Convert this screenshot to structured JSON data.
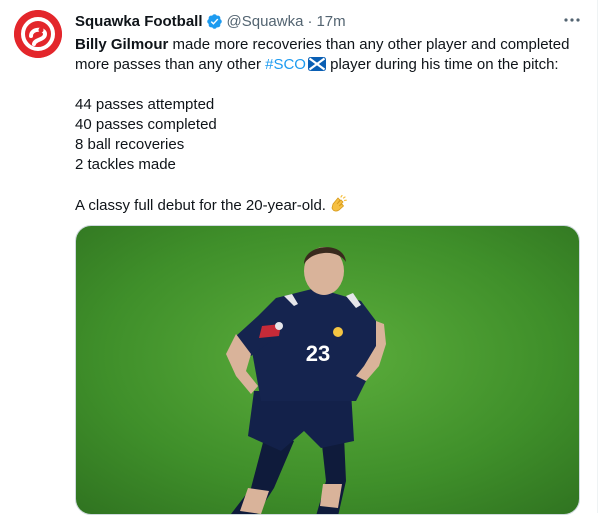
{
  "account": {
    "name": "Squawka Football",
    "handle": "@Squawka",
    "separator": "·",
    "time": "17m",
    "avatar_icon": "squawka-logo-icon",
    "verified_icon": "verified-badge-icon",
    "brand_color": "#e3262b"
  },
  "tweet": {
    "line1_name": "Billy Gilmour",
    "line1_rest": " made more recoveries than any other player and completed",
    "line2_before": "more passes than any other ",
    "hashtag": "#SCO",
    "flag_icon": "scotland-flag-icon",
    "line2_after": " player during his time on the pitch:",
    "stats": [
      "44 passes attempted",
      "40 passes completed",
      "8 ball recoveries",
      "2 tackles made"
    ],
    "closing": "A classy full debut for the 20-year-old.",
    "clap_icon": "clapping-hands-icon",
    "hashtag_color": "#1d9bf0"
  },
  "media": {
    "jersey_number": "23"
  }
}
